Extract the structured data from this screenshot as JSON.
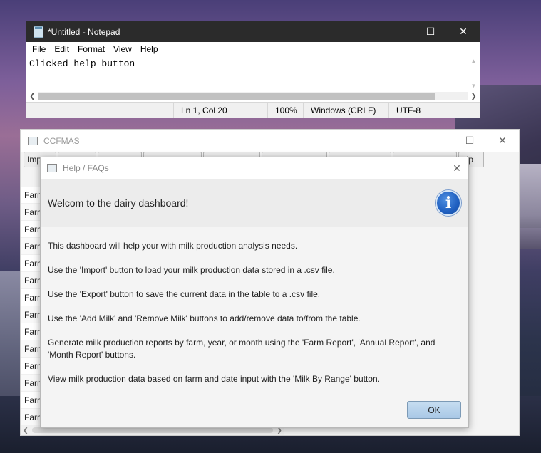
{
  "notepad": {
    "title": "*Untitled - Notepad",
    "menu": [
      "File",
      "Edit",
      "Format",
      "View",
      "Help"
    ],
    "content": "Clicked help button",
    "status": {
      "position": "Ln 1, Col 20",
      "zoom": "100%",
      "line_ending": "Windows (CRLF)",
      "encoding": "UTF-8"
    }
  },
  "ccfmas": {
    "title": "CCFMAS",
    "toolbar": [
      "Imp",
      "",
      "",
      "",
      "",
      "",
      "",
      "",
      "",
      "elp"
    ],
    "rows": [
      "Farm",
      "Farm",
      "Farm",
      "Farm",
      "Farm",
      "Farm",
      "Farm",
      "Farm",
      "Farm",
      "Farm",
      "Farm",
      "Farm",
      "Farm",
      "Farm"
    ]
  },
  "dialog": {
    "title": "Help / FAQs",
    "header": "Welcom to the dairy dashboard!",
    "paragraphs": [
      "This dashboard will help your with milk production analysis needs.",
      "Use the 'Import' button to load your milk production data stored in a .csv file.",
      "Use the 'Export' button to save the current data in the table to a .csv file.",
      "Use the 'Add Milk' and 'Remove Milk' buttons to add/remove data to/from the table.",
      "Generate milk production reports by farm, year, or month using the 'Farm Report', 'Annual Report', and 'Month Report' buttons.",
      "View milk production data based on farm and date input with the 'Milk By Range' button."
    ],
    "ok_label": "OK"
  }
}
